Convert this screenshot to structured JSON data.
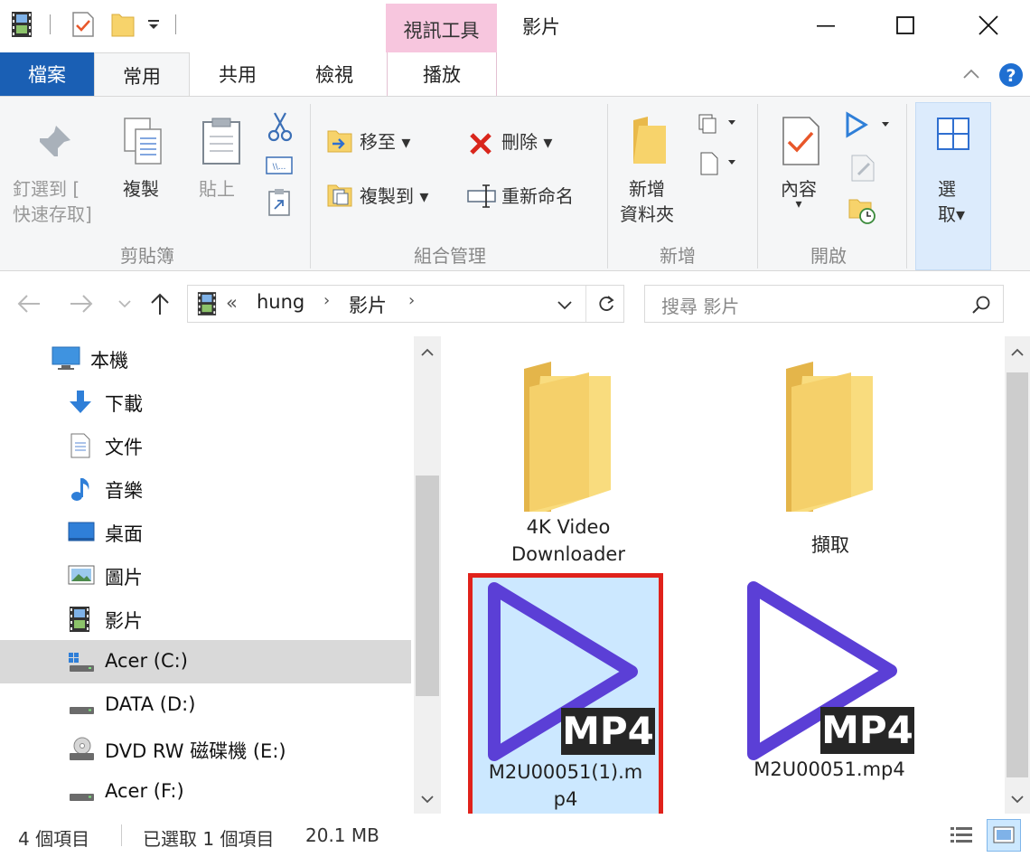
{
  "window": {
    "context_tab": "視訊工具",
    "title": "影片"
  },
  "tabs": {
    "file": "檔案",
    "home": "常用",
    "share": "共用",
    "view": "檢視",
    "play": "播放"
  },
  "ribbon": {
    "pin": [
      "釘選到 [",
      "快速存取]"
    ],
    "copy": "複製",
    "paste": "貼上",
    "clipboard_group": "剪貼簿",
    "move_to": "移至",
    "copy_to": "複製到",
    "delete": "刪除",
    "rename": "重新命名",
    "organize_group": "組合管理",
    "new_folder": [
      "新增",
      "資料夾"
    ],
    "new_group": "新增",
    "properties": "內容",
    "open_group": "開啟",
    "select": [
      "選",
      "取"
    ]
  },
  "address": {
    "path": [
      "hung",
      "影片"
    ],
    "overflow": "«",
    "search_placeholder": "搜尋 影片"
  },
  "nav": {
    "items": [
      {
        "label": "本機",
        "icon": "computer-icon"
      },
      {
        "label": "下載",
        "icon": "download-arrow-icon"
      },
      {
        "label": "文件",
        "icon": "document-icon"
      },
      {
        "label": "音樂",
        "icon": "music-note-icon"
      },
      {
        "label": "桌面",
        "icon": "desktop-icon"
      },
      {
        "label": "圖片",
        "icon": "pictures-icon"
      },
      {
        "label": "影片",
        "icon": "film-icon"
      },
      {
        "label": "Acer (C:)",
        "icon": "windows-drive-icon"
      },
      {
        "label": "DATA (D:)",
        "icon": "drive-icon"
      },
      {
        "label": "DVD RW 磁碟機 (E:)",
        "icon": "dvd-drive-icon"
      },
      {
        "label": "Acer (F:)",
        "icon": "drive-icon"
      }
    ]
  },
  "content": {
    "items": [
      {
        "name": [
          "4K Video",
          "Downloader"
        ],
        "type": "folder"
      },
      {
        "name": [
          "擷取"
        ],
        "type": "folder"
      },
      {
        "name": [
          "M2U00051(1).m",
          "p4"
        ],
        "type": "video",
        "badge": "MP4"
      },
      {
        "name": [
          "M2U00051.mp4"
        ],
        "type": "video",
        "badge": "MP4"
      }
    ]
  },
  "status": {
    "count": "4 個項目",
    "selected": "已選取 1 個項目",
    "size": "20.1 MB"
  },
  "colors": {
    "accent": "#1a5fb4",
    "context_tab": "#f7c6de",
    "play_icon": "#5b3fd6",
    "highlight_border": "#e0221b",
    "selection": "#cce8ff"
  }
}
